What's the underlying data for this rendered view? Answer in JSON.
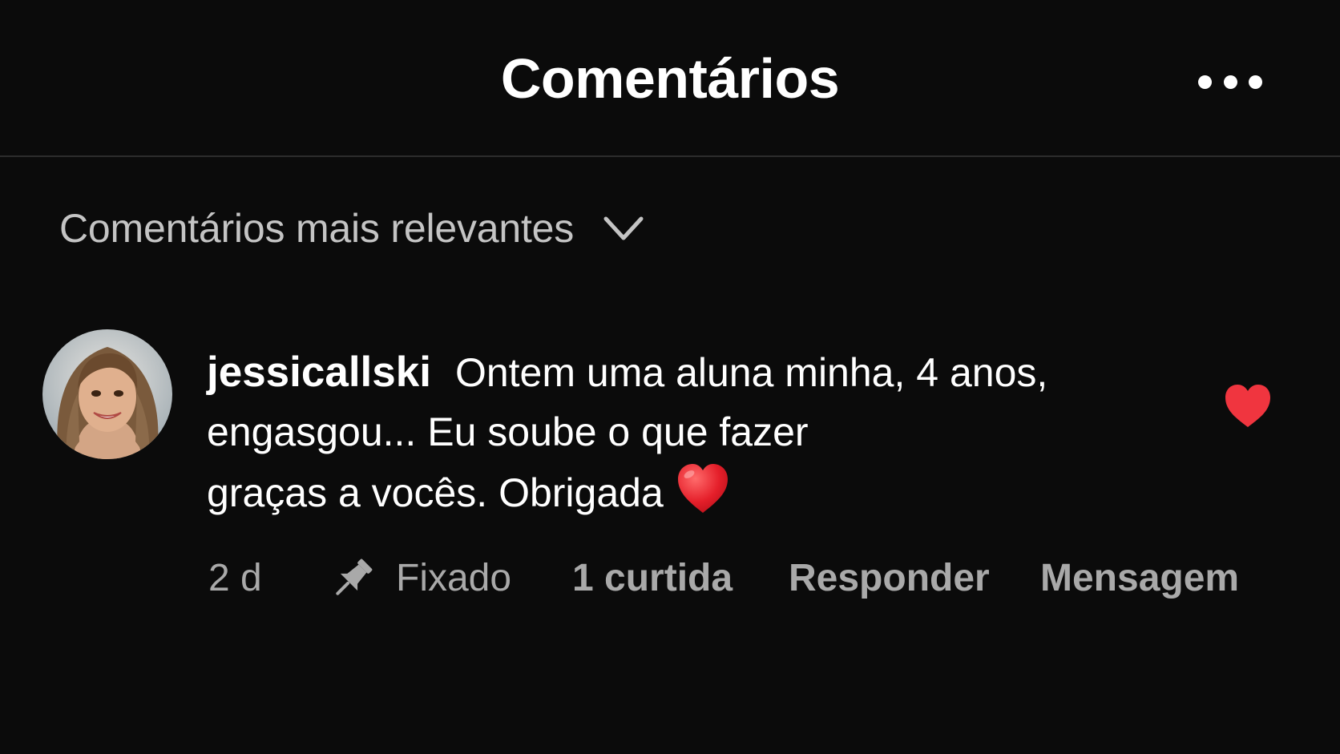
{
  "header": {
    "title": "Comentários",
    "more_icon": "more-horizontal-icon"
  },
  "sort": {
    "label": "Comentários mais relevantes",
    "icon": "chevron-down-icon"
  },
  "comment": {
    "username": "jessicallski",
    "text_lines": [
      "Ontem uma aluna minha, 4 anos,",
      "engasgou... Eu soube o que fazer",
      "graças a vocês. Obrigada"
    ],
    "emoji": "❤️",
    "liked": true,
    "like_color": "#f0353f",
    "actions": {
      "time": "2 d",
      "pinned": "Fixado",
      "likes": "1 curtida",
      "reply": "Responder",
      "message": "Mensagem"
    }
  },
  "colors": {
    "background": "#0b0b0b",
    "primary_text": "#ffffff",
    "secondary_text": "#a9a9a9",
    "divider": "#2c2c2c"
  }
}
